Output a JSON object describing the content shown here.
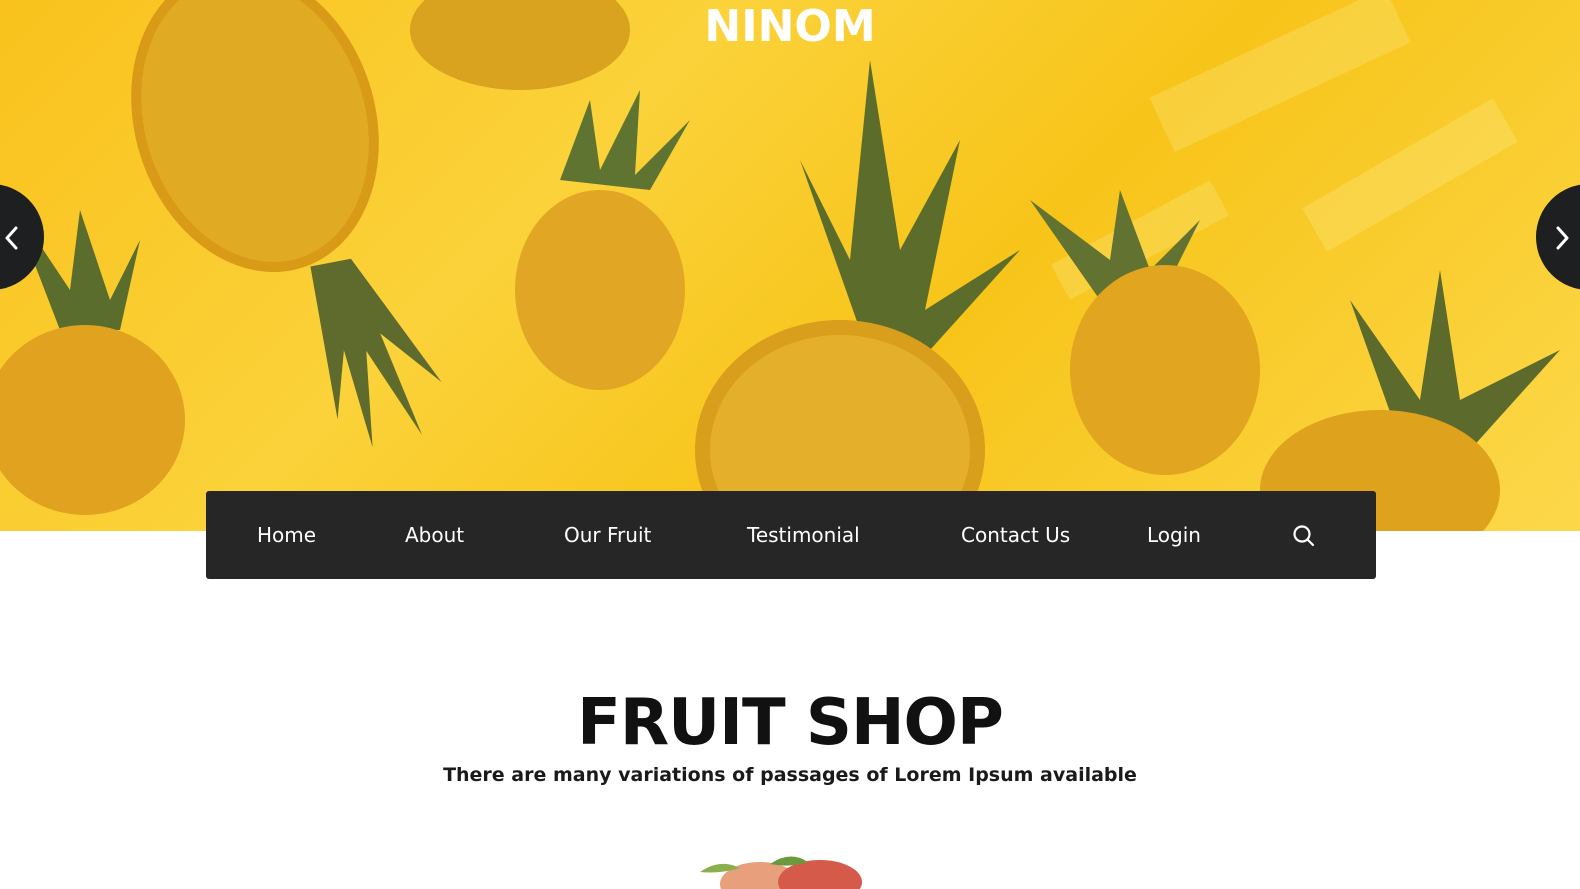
{
  "header": {
    "logo": "NINOM"
  },
  "slider": {
    "prev_icon": "chevron-left-icon",
    "next_icon": "chevron-right-icon"
  },
  "nav": {
    "items": [
      {
        "label": "Home"
      },
      {
        "label": "About"
      },
      {
        "label": "Our Fruit"
      },
      {
        "label": "Testimonial"
      },
      {
        "label": "Contact Us"
      },
      {
        "label": "Login"
      }
    ],
    "search_icon": "search-icon"
  },
  "main": {
    "title": "FRUIT SHOP",
    "subtitle": "There are many variations of passages of Lorem Ipsum available"
  },
  "colors": {
    "hero_yellow": "#f9c21c",
    "nav_bg": "#262626",
    "text_dark": "#111111",
    "arrow_bg": "#1e1f20"
  }
}
